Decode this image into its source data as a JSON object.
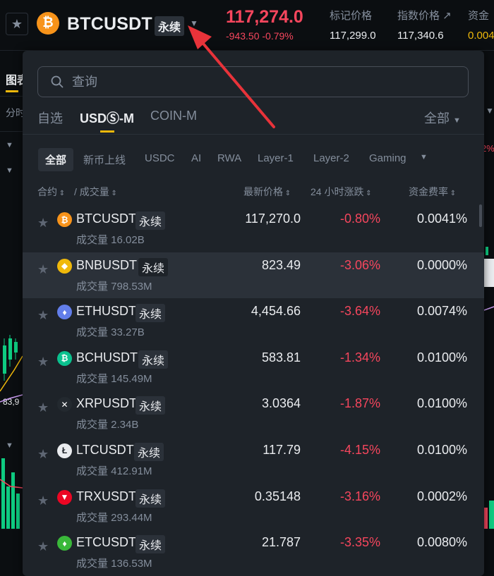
{
  "header": {
    "symbol": "BTCUSDT",
    "coin_glyph": "₿",
    "perp_badge": "永续",
    "last_price": "117,274.0",
    "change": "-943.50 -0.79%",
    "stats": [
      {
        "label": "标记价格",
        "value": "117,299.0"
      },
      {
        "label": "指数价格 ↗",
        "value": "117,340.6"
      },
      {
        "label": "资金",
        "value": "0.004"
      }
    ]
  },
  "background": {
    "tab_label": "图表",
    "sub_label": "分时",
    "right_red": "2%",
    "price_tag": "83,9"
  },
  "search": {
    "placeholder": "查询"
  },
  "tabs": [
    {
      "label": "自选",
      "active": false
    },
    {
      "label": "USDⓈ-M",
      "active": true
    },
    {
      "label": "COIN-M",
      "active": false
    }
  ],
  "all_select": "全部",
  "chips": [
    "全部",
    "新币上线",
    "USDC",
    "AI",
    "RWA",
    "Layer-1",
    "Layer-2",
    "Gaming"
  ],
  "columns": {
    "contract": "合约",
    "volume": "/ 成交量",
    "last_price": "最新价格",
    "change24h": "24 小时涨跌",
    "funding": "资金费率"
  },
  "rows": [
    {
      "symbol": "BTCUSDT",
      "badge": "永续",
      "volume": "成交量 16.02B",
      "price": "117,270.0",
      "change": "-0.80%",
      "funding": "0.0041%",
      "logo_color": "#f7931a",
      "logo_glyph": "₿"
    },
    {
      "symbol": "BNBUSDT",
      "badge": "永续",
      "volume": "成交量 798.53M",
      "price": "823.49",
      "change": "-3.06%",
      "funding": "0.0000%",
      "logo_color": "#f0b90b",
      "logo_glyph": "◆"
    },
    {
      "symbol": "ETHUSDT",
      "badge": "永续",
      "volume": "成交量 33.27B",
      "price": "4,454.66",
      "change": "-3.64%",
      "funding": "0.0074%",
      "logo_color": "#627eea",
      "logo_glyph": "♦"
    },
    {
      "symbol": "BCHUSDT",
      "badge": "永续",
      "volume": "成交量 145.49M",
      "price": "583.81",
      "change": "-1.34%",
      "funding": "0.0100%",
      "logo_color": "#0ac18e",
      "logo_glyph": "₿"
    },
    {
      "symbol": "XRPUSDT",
      "badge": "永续",
      "volume": "成交量 2.34B",
      "price": "3.0364",
      "change": "-1.87%",
      "funding": "0.0100%",
      "logo_color": "#23292f",
      "logo_glyph": "✕"
    },
    {
      "symbol": "LTCUSDT",
      "badge": "永续",
      "volume": "成交量 412.91M",
      "price": "117.79",
      "change": "-4.15%",
      "funding": "0.0100%",
      "logo_color": "#eaecef",
      "logo_glyph": "Ł"
    },
    {
      "symbol": "TRXUSDT",
      "badge": "永续",
      "volume": "成交量 293.44M",
      "price": "0.35148",
      "change": "-3.16%",
      "funding": "0.0002%",
      "logo_color": "#ec0623",
      "logo_glyph": "▼"
    },
    {
      "symbol": "ETCUSDT",
      "badge": "永续",
      "volume": "成交量 136.53M",
      "price": "21.787",
      "change": "-3.35%",
      "funding": "0.0080%",
      "logo_color": "#3ab83a",
      "logo_glyph": "♦"
    }
  ],
  "colors": {
    "accent": "#f0b90b",
    "down": "#f6465d",
    "up": "#0ecb81",
    "annotation": "#e8333a"
  }
}
